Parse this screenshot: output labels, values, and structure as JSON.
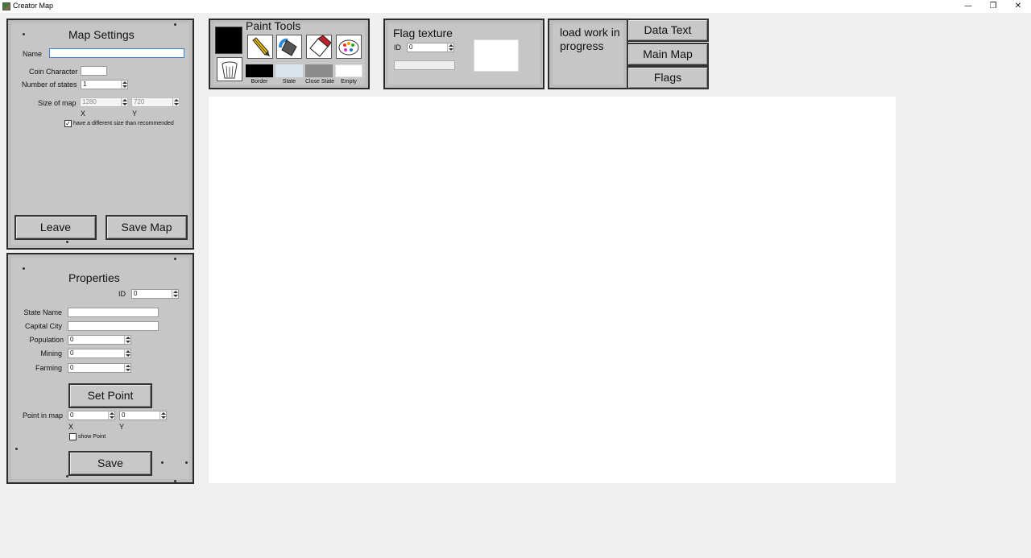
{
  "window": {
    "title": "Creator Map",
    "minimize": "—",
    "restore": "❐",
    "close": "✕"
  },
  "map_settings": {
    "heading": "Map Settings",
    "name_label": "Name",
    "name_value": "",
    "coin_label": "Coin Character",
    "coin_value": "",
    "states_label": "Number of states",
    "states_value": "1",
    "size_label": "Size of map",
    "size_x": "1280",
    "size_y": "720",
    "x_label": "X",
    "y_label": "Y",
    "diff_size_label": "have a different size than recommended",
    "diff_size_checked": "✓",
    "leave_label": "Leave",
    "save_map_label": "Save Map"
  },
  "properties": {
    "heading": "Properties",
    "id_label": "ID",
    "id_value": "0",
    "state_name_label": "State Name",
    "state_name_value": "",
    "capital_label": "Capital City",
    "capital_value": "",
    "population_label": "Population",
    "population_value": "0",
    "mining_label": "Mining",
    "mining_value": "0",
    "farming_label": "Farming",
    "farming_value": "0",
    "set_point_label": "Set Point",
    "point_label": "Point in map",
    "point_x": "0",
    "point_y": "0",
    "x_label": "X",
    "y_label": "Y",
    "show_point_label": "show Point",
    "save_label": "Save"
  },
  "paint_tools": {
    "heading": "Paint Tools",
    "tools": [
      "pencil-icon",
      "fill-bucket-icon",
      "eraser-icon",
      "palette-icon",
      "trash-bin-icon"
    ],
    "swatches": [
      {
        "label": "Border",
        "color": "#000000"
      },
      {
        "label": "State",
        "color": "#d9e4ea"
      },
      {
        "label": "Close State",
        "color": "#8a8a8a"
      },
      {
        "label": "Empty",
        "color": "#ffffff"
      }
    ],
    "current_color": "#000000"
  },
  "flag_texture": {
    "heading": "Flag texture",
    "id_label": "ID",
    "id_value": "0",
    "path_value": ""
  },
  "load_panel": {
    "text": "load work in progress"
  },
  "nav": {
    "data_text": "Data Text",
    "main_map": "Main Map",
    "flags": "Flags"
  }
}
